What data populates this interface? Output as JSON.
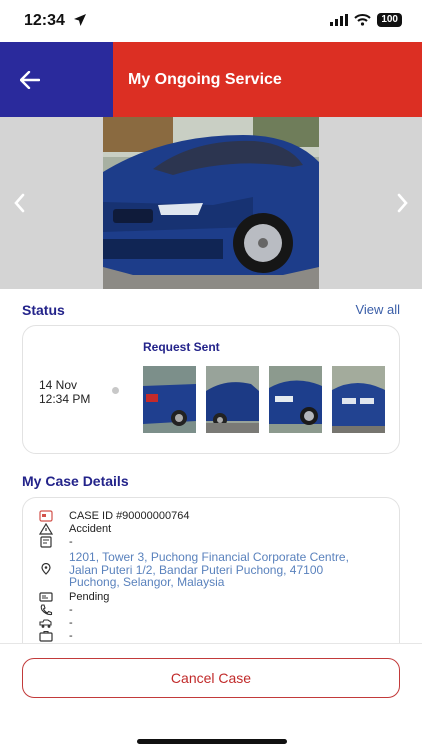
{
  "status_bar": {
    "time": "12:34",
    "battery": "100"
  },
  "header": {
    "title": "My Ongoing Service",
    "back_icon": "arrow-left-icon",
    "left_color": "#2a2a9c",
    "right_color": "#dc2f23"
  },
  "status": {
    "section_title": "Status",
    "view_all": "View all",
    "request_label": "Request Sent",
    "date": "14 Nov",
    "time": "12:34 PM"
  },
  "case_details": {
    "section_title": "My Case Details",
    "case_id": "CASE ID #90000000764",
    "type": "Accident",
    "note": "-",
    "address_line1": "1201, Tower 3, Puchong Financial Corporate Centre,",
    "address_line2": "Jalan Puteri 1/2, Bandar Puteri Puchong, 47100",
    "address_line3": "Puchong, Selangor, Malaysia",
    "state": "Pending",
    "phone": "-",
    "vehicle": "-",
    "extra": "-"
  },
  "actions": {
    "cancel_label": "Cancel Case"
  }
}
